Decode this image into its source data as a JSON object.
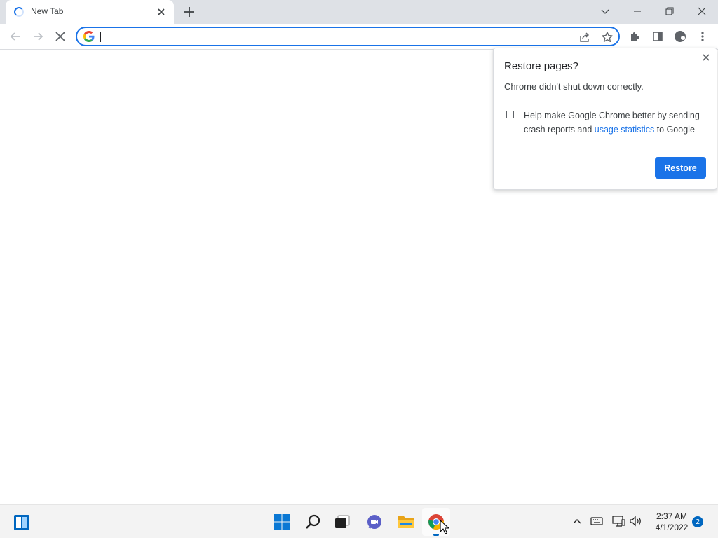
{
  "browser": {
    "tab": {
      "title": "New Tab",
      "status": "loading"
    },
    "address_bar": {
      "value": "",
      "placeholder": ""
    }
  },
  "restore_bubble": {
    "title": "Restore pages?",
    "subtitle": "Chrome didn't shut down correctly.",
    "checkbox_text_before": "Help make Google Chrome better by sending crash reports and ",
    "checkbox_link": "usage statistics",
    "checkbox_text_after": " to Google",
    "checkbox_checked": false,
    "button_label": "Restore"
  },
  "taskbar": {
    "pinned": [
      "widgets",
      "start",
      "search",
      "task-view",
      "chat",
      "file-explorer",
      "chrome"
    ],
    "active_app": "chrome",
    "clock_time": "2:37 AM",
    "clock_date": "4/1/2022",
    "notification_count": "2"
  },
  "colors": {
    "accent": "#1a73e8",
    "tabstrip_bg": "#dee1e6",
    "taskbar_bg": "#f3f3f3",
    "windows_blue": "#0067c0"
  }
}
